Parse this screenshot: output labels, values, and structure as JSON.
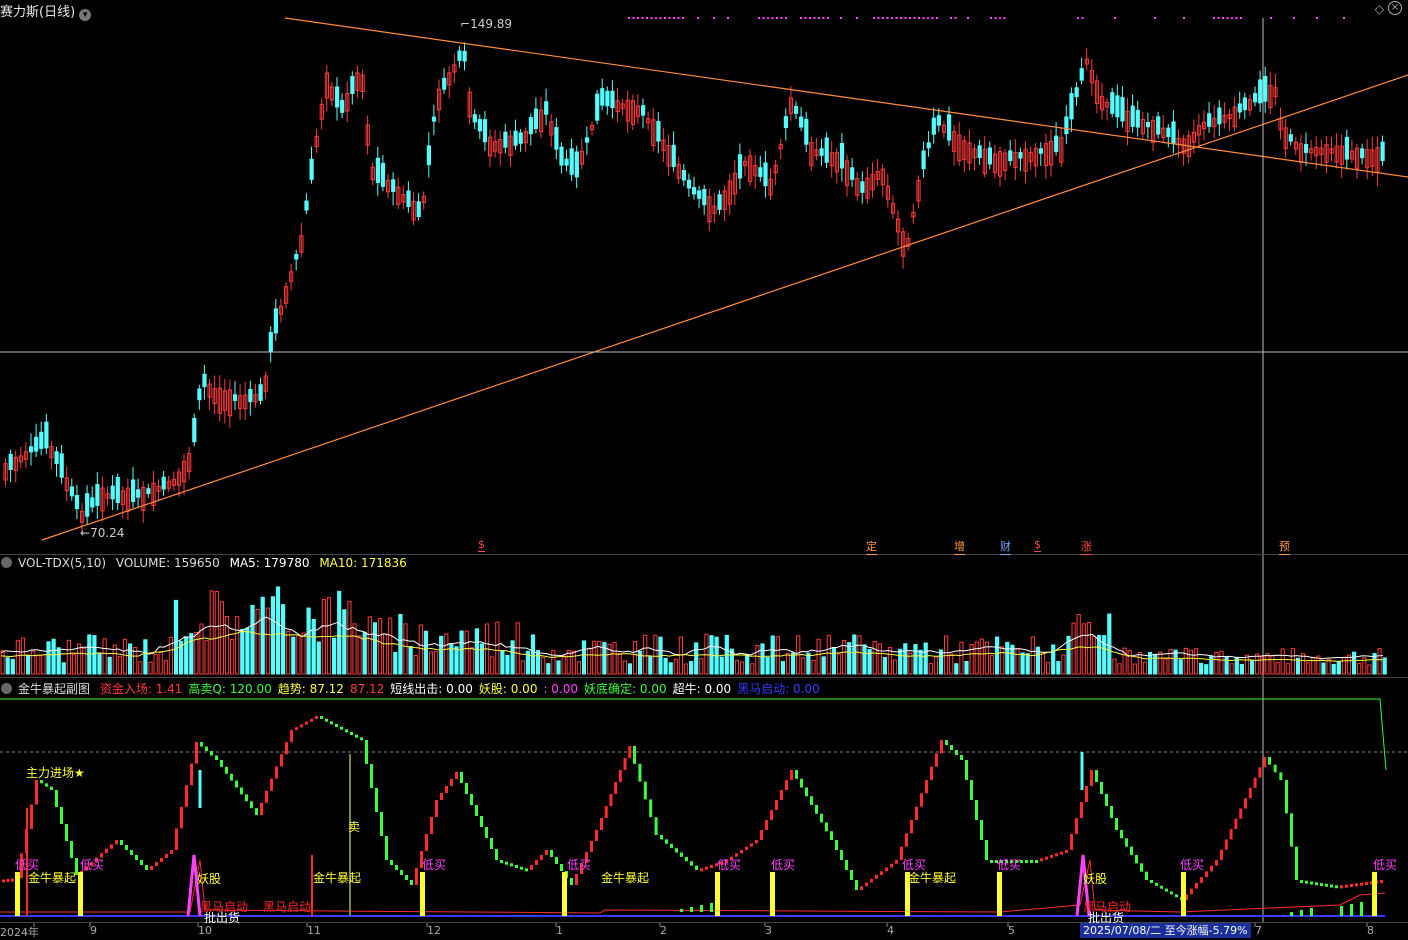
{
  "window": {
    "title": "赛力斯(日线)",
    "nav_prev_icon": "diamond-icon",
    "close_icon": "close-icon"
  },
  "price_panel": {
    "high_label": "149.89",
    "low_label": "70.24",
    "event_markers": [
      {
        "glyph": "$",
        "color": "#ff4a4a"
      },
      {
        "glyph": "定",
        "color": "#ff9a3a"
      },
      {
        "glyph": "增",
        "color": "#ff9a3a"
      },
      {
        "glyph": "财",
        "color": "#6fa8ff"
      },
      {
        "glyph": "$",
        "color": "#ff4a4a"
      },
      {
        "glyph": "涨",
        "color": "#ff4a4a"
      },
      {
        "glyph": "预",
        "color": "#ff9a3a"
      }
    ]
  },
  "volume_panel": {
    "indicator": "VOL-TDX(5,10)",
    "volume_label": "VOLUME: 159650",
    "ma5_label": "MA5: 179780",
    "ma10_label": "MA10: 171836"
  },
  "sub_panel": {
    "name": "金牛暴起副图",
    "fields": [
      {
        "text": "资金入场: 1.41",
        "color": "#ff3a3a"
      },
      {
        "text": "高卖Q: 120.00",
        "color": "#3aff3a"
      },
      {
        "text": "趋势: 87.12",
        "color": "#ffff40"
      },
      {
        "text": "87.12",
        "color": "#ff3a3a"
      },
      {
        "text": "短线出击: 0.00",
        "color": "#ffffff"
      },
      {
        "text": "妖股: 0.00",
        "color": "#ffff40"
      },
      {
        "text": ": 0.00",
        "color": "#ff40ff"
      },
      {
        "text": "妖底确定: 0.00",
        "color": "#3aff3a"
      },
      {
        "text": "超牛: 0.00",
        "color": "#ffffff"
      },
      {
        "text": "黑马启动: 0.00",
        "color": "#3a3aff"
      }
    ],
    "signals": {
      "main_entry": "主力进场★",
      "low_buy": "低买",
      "bull_surge": "金牛暴起",
      "demon_stock": "妖股",
      "dark_horse": "黑马启动",
      "sell": "卖",
      "batch_out": "批出货"
    }
  },
  "x_axis": {
    "labels": [
      "2024年",
      "9",
      "10",
      "11",
      "12",
      "1",
      "2",
      "3",
      "4",
      "5",
      "7",
      "8"
    ],
    "status_text": "2025/07/08/二  至今涨幅-5.79%"
  },
  "colors": {
    "up": "#ff3a3a",
    "down": "#54ffff",
    "trendline": "#ff8c3a",
    "ma5": "#ffffff",
    "ma10": "#ffff40"
  },
  "chart_data": {
    "type": "candlestick",
    "series": [
      {
        "name": "price_high_low_marks",
        "values": [
          149.89,
          70.24
        ]
      },
      {
        "name": "VOLUME",
        "values": [
          159650
        ]
      },
      {
        "name": "MA5",
        "values": [
          179780
        ]
      },
      {
        "name": "MA10",
        "values": [
          171836
        ]
      }
    ],
    "categories": [
      "2024年",
      "9",
      "10",
      "11",
      "12",
      "1",
      "2",
      "3",
      "4",
      "5",
      "7",
      "8"
    ]
  }
}
